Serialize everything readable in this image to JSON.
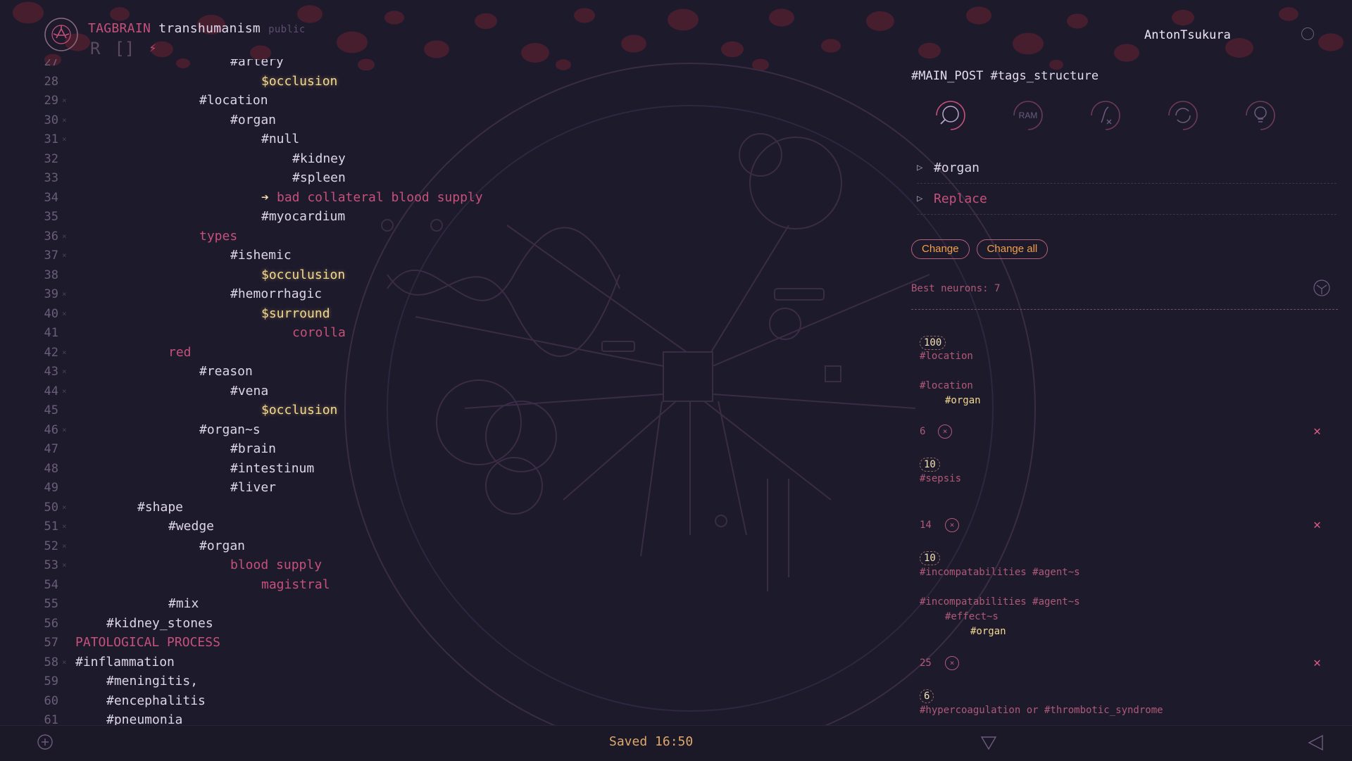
{
  "app": {
    "brand": "TAGBRAIN",
    "project": "transhumanism",
    "visibility": "public",
    "user": "AntonTsukura",
    "modes": [
      {
        "icon": "r-mode-icon",
        "glyph": "R"
      },
      {
        "icon": "bracket-mode-icon",
        "glyph": "[]"
      },
      {
        "icon": "bolt-icon",
        "glyph": "⚡"
      }
    ]
  },
  "editor": {
    "lines": [
      {
        "num": "27",
        "marker": "",
        "indent": 5,
        "text": "#artery",
        "kind": "tag"
      },
      {
        "num": "28",
        "marker": "",
        "indent": 6,
        "text": "$occlusion",
        "kind": "var"
      },
      {
        "num": "29",
        "marker": "×",
        "indent": 4,
        "text": "#location",
        "kind": "tag"
      },
      {
        "num": "30",
        "marker": "×",
        "indent": 5,
        "text": "#organ",
        "kind": "tag"
      },
      {
        "num": "31",
        "marker": "×",
        "indent": 6,
        "text": "#null",
        "kind": "tag"
      },
      {
        "num": "32",
        "marker": "",
        "indent": 7,
        "text": "#kidney",
        "kind": "tag"
      },
      {
        "num": "33",
        "marker": "",
        "indent": 7,
        "text": "#spleen",
        "kind": "tag"
      },
      {
        "num": "34",
        "marker": "",
        "indent": 6,
        "text": "bad collateral blood supply",
        "kind": "link",
        "arrow": "➔"
      },
      {
        "num": "35",
        "marker": "",
        "indent": 6,
        "text": "#myocardium",
        "kind": "tag"
      },
      {
        "num": "36",
        "marker": "×",
        "indent": 4,
        "text": "types",
        "kind": "plain"
      },
      {
        "num": "37",
        "marker": "×",
        "indent": 5,
        "text": "#ishemic",
        "kind": "tag"
      },
      {
        "num": "38",
        "marker": "",
        "indent": 6,
        "text": "$occulusion",
        "kind": "var"
      },
      {
        "num": "39",
        "marker": "×",
        "indent": 5,
        "text": "#hemorrhagic",
        "kind": "tag"
      },
      {
        "num": "40",
        "marker": "×",
        "indent": 6,
        "text": "$surround",
        "kind": "var"
      },
      {
        "num": "41",
        "marker": "",
        "indent": 7,
        "text": "corolla",
        "kind": "plain"
      },
      {
        "num": "42",
        "marker": "×",
        "indent": 3,
        "text": "red",
        "kind": "plain"
      },
      {
        "num": "43",
        "marker": "×",
        "indent": 4,
        "text": "#reason",
        "kind": "tag"
      },
      {
        "num": "44",
        "marker": "×",
        "indent": 5,
        "text": "#vena",
        "kind": "tag"
      },
      {
        "num": "45",
        "marker": "",
        "indent": 6,
        "text": "$occlusion",
        "kind": "var"
      },
      {
        "num": "46",
        "marker": "×",
        "indent": 4,
        "text": "#organ~s",
        "kind": "tag",
        "suffix_color": true
      },
      {
        "num": "47",
        "marker": "",
        "indent": 5,
        "text": "#brain",
        "kind": "tag"
      },
      {
        "num": "48",
        "marker": "",
        "indent": 5,
        "text": "#intestinum",
        "kind": "tag"
      },
      {
        "num": "49",
        "marker": "",
        "indent": 5,
        "text": "#liver",
        "kind": "tag"
      },
      {
        "num": "50",
        "marker": "×",
        "indent": 2,
        "text": "#shape",
        "kind": "tag"
      },
      {
        "num": "51",
        "marker": "×",
        "indent": 3,
        "text": "#wedge",
        "kind": "tag"
      },
      {
        "num": "52",
        "marker": "×",
        "indent": 4,
        "text": "#organ",
        "kind": "tag"
      },
      {
        "num": "53",
        "marker": "×",
        "indent": 5,
        "text": "blood supply",
        "kind": "plain"
      },
      {
        "num": "54",
        "marker": "",
        "indent": 6,
        "text": "magistral",
        "kind": "plain"
      },
      {
        "num": "55",
        "marker": "",
        "indent": 3,
        "text": "#mix",
        "kind": "tag"
      },
      {
        "num": "56",
        "marker": "",
        "indent": 1,
        "text": "#kidney_stones",
        "kind": "tag"
      },
      {
        "num": "57",
        "marker": "",
        "indent": 0,
        "text": "PATOLOGICAL PROCESS",
        "kind": "plain"
      },
      {
        "num": "58",
        "marker": "×",
        "indent": 0,
        "text": "#inflammation",
        "kind": "tag"
      },
      {
        "num": "59",
        "marker": "",
        "indent": 1,
        "text": "#meningitis,",
        "kind": "tag"
      },
      {
        "num": "60",
        "marker": "",
        "indent": 1,
        "text": "#encephalitis",
        "kind": "tag"
      },
      {
        "num": "61",
        "marker": "",
        "indent": 1,
        "text": "#pneumonia",
        "kind": "tag"
      }
    ]
  },
  "panel": {
    "post_title": "#MAIN_POST #tags_structure",
    "tools": [
      {
        "name": "search-tool-button",
        "icon": "magnifier-icon"
      },
      {
        "name": "ram-tool-button",
        "icon": "ram-icon",
        "label": "RAM"
      },
      {
        "name": "function-tool-button",
        "icon": "function-icon"
      },
      {
        "name": "refresh-tool-button",
        "icon": "refresh-icon"
      },
      {
        "name": "idea-tool-button",
        "icon": "lightbulb-icon"
      }
    ],
    "find_label": "#organ",
    "replace_label": "Replace",
    "change_label": "Change",
    "change_all_label": "Change all",
    "best_neurons": "Best neurons: 7",
    "results": [
      {
        "type": "score",
        "value": "100"
      },
      {
        "type": "text",
        "value": "#location"
      },
      {
        "type": "text",
        "value": "#location"
      },
      {
        "type": "text",
        "value": "#organ",
        "hl": true
      },
      {
        "type": "count",
        "value": "6"
      },
      {
        "type": "score",
        "value": "10"
      },
      {
        "type": "text",
        "value": "#sepsis"
      },
      {
        "type": "count",
        "value": "14"
      },
      {
        "type": "score",
        "value": "10"
      },
      {
        "type": "text",
        "value": "#incompatabilities #agent~s"
      },
      {
        "type": "text",
        "value": "#incompatabilities #agent~s"
      },
      {
        "type": "text",
        "value": "#effect~s"
      },
      {
        "type": "text",
        "value": "#organ",
        "hl": true
      },
      {
        "type": "count",
        "value": "25"
      },
      {
        "type": "score",
        "value": "6"
      },
      {
        "type": "text",
        "value": "#hypercoagulation or #thrombotic_syndrome"
      }
    ]
  },
  "footer": {
    "saved": "Saved 16:50"
  },
  "colors": {
    "background": "#1d1a2c",
    "accent": "#c6517a",
    "variable": "#f4d98f",
    "button_text": "#f2a04a"
  }
}
